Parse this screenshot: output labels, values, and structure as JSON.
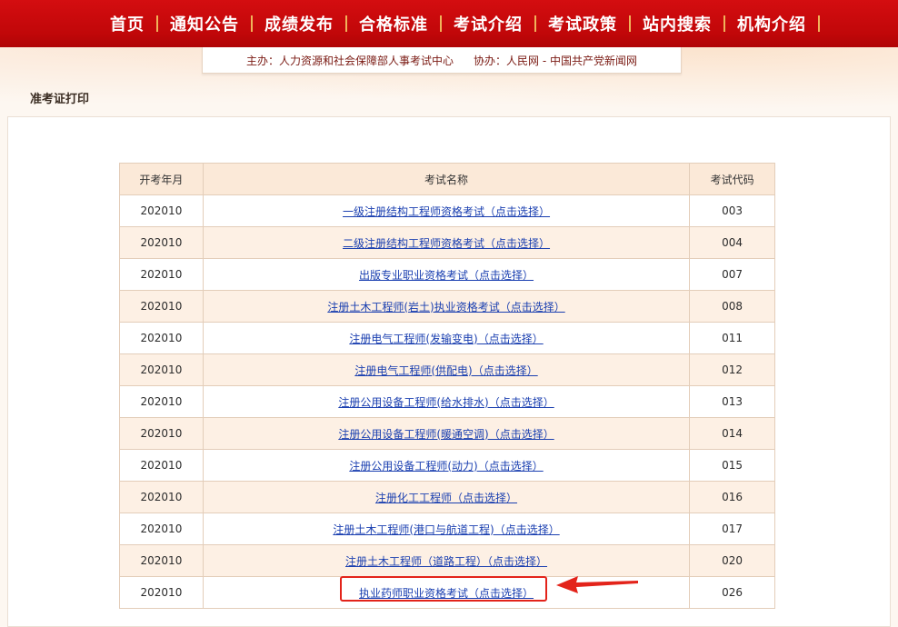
{
  "nav": {
    "items": [
      "首页",
      "通知公告",
      "成绩发布",
      "合格标准",
      "考试介绍",
      "考试政策",
      "站内搜索",
      "机构介绍"
    ]
  },
  "sponsor": {
    "host": "主办：人力资源和社会保障部人事考试中心",
    "co": "协办：人民网 - 中国共产党新闻网"
  },
  "page_title": "准考证打印",
  "table": {
    "headers": [
      "开考年月",
      "考试名称",
      "考试代码"
    ],
    "rows": [
      {
        "month": "202010",
        "name": "一级注册结构工程师资格考试（点击选择）",
        "code": "003"
      },
      {
        "month": "202010",
        "name": "二级注册结构工程师资格考试（点击选择）",
        "code": "004"
      },
      {
        "month": "202010",
        "name": "出版专业职业资格考试（点击选择）",
        "code": "007"
      },
      {
        "month": "202010",
        "name": "注册土木工程师(岩土)执业资格考试（点击选择）",
        "code": "008"
      },
      {
        "month": "202010",
        "name": "注册电气工程师(发输变电)（点击选择）",
        "code": "011"
      },
      {
        "month": "202010",
        "name": "注册电气工程师(供配电)（点击选择）",
        "code": "012"
      },
      {
        "month": "202010",
        "name": "注册公用设备工程师(给水排水)（点击选择）",
        "code": "013"
      },
      {
        "month": "202010",
        "name": "注册公用设备工程师(暖通空调)（点击选择）",
        "code": "014"
      },
      {
        "month": "202010",
        "name": "注册公用设备工程师(动力)（点击选择）",
        "code": "015"
      },
      {
        "month": "202010",
        "name": "注册化工工程师（点击选择）",
        "code": "016"
      },
      {
        "month": "202010",
        "name": "注册土木工程师(港口与航道工程)（点击选择）",
        "code": "017"
      },
      {
        "month": "202010",
        "name": "注册土木工程师（道路工程）（点击选择）",
        "code": "020"
      },
      {
        "month": "202010",
        "name": "执业药师职业资格考试（点击选择）",
        "code": "026"
      }
    ]
  },
  "colors": {
    "brand_red": "#c10709",
    "link": "#1a3fb0",
    "highlight": "#e3231a"
  }
}
